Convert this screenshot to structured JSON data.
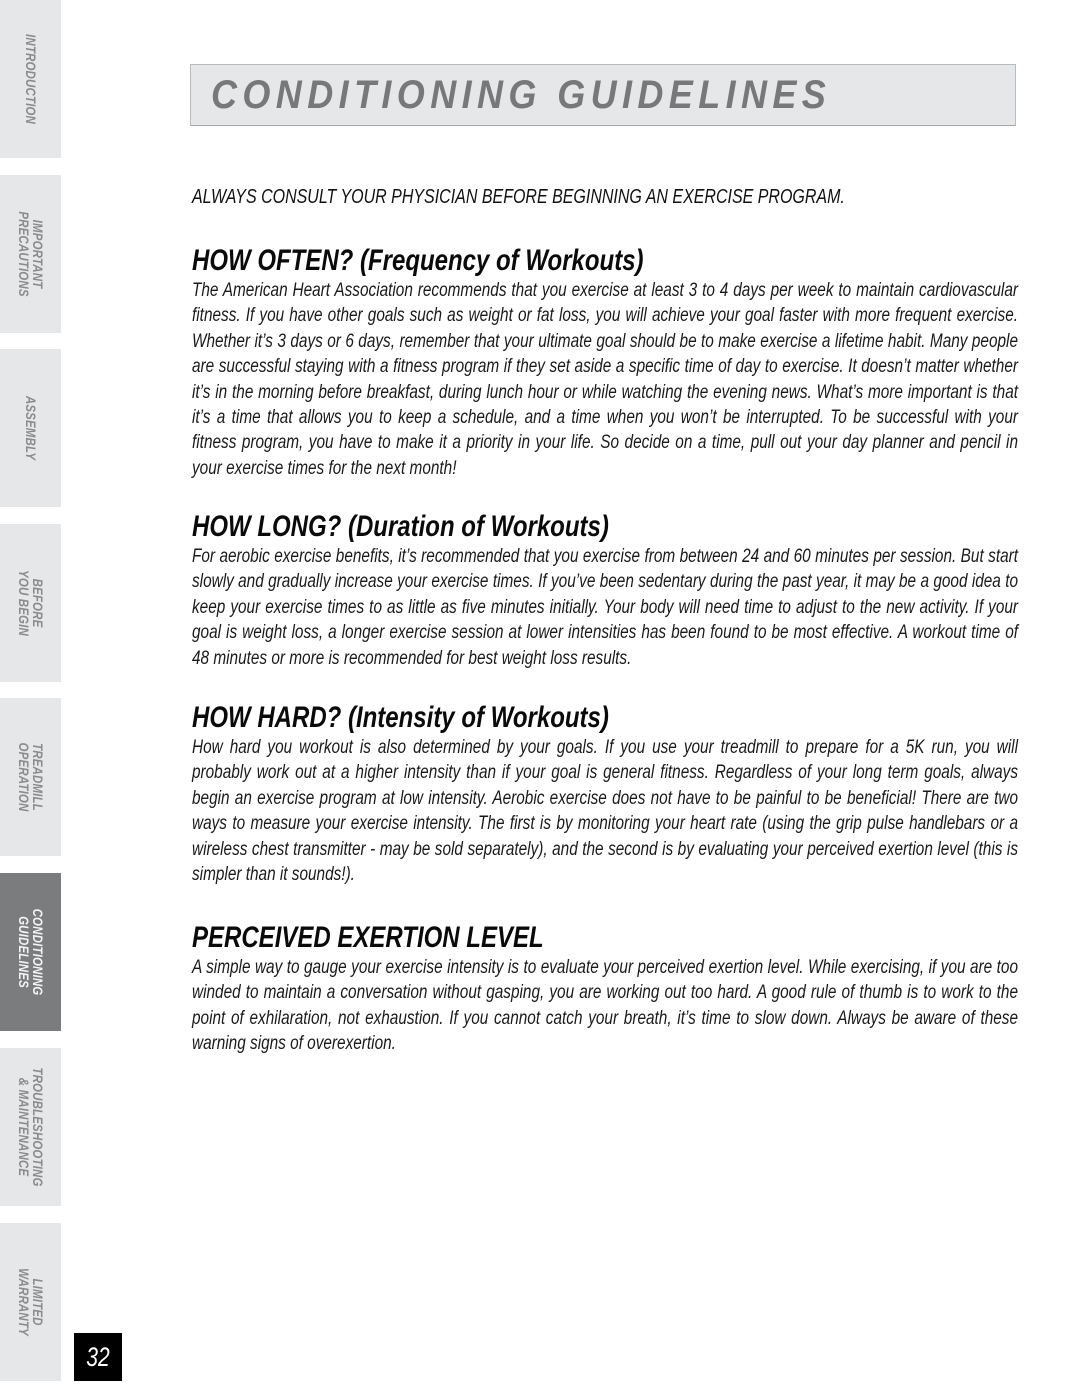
{
  "sidebar": {
    "tabs": [
      {
        "lines": [
          "INTRODUCTION"
        ],
        "active": false
      },
      {
        "lines": [
          "IMPORTANT",
          "PRECAUTIONS"
        ],
        "active": false
      },
      {
        "lines": [
          "ASSEMBLY"
        ],
        "active": false
      },
      {
        "lines": [
          "BEFORE",
          "YOU BEGIN"
        ],
        "active": false
      },
      {
        "lines": [
          "TREADMILL",
          "OPERATION"
        ],
        "active": false
      },
      {
        "lines": [
          "CONDITIONING",
          "GUIDELINES"
        ],
        "active": true
      },
      {
        "lines": [
          "TROUBLESHOOTING",
          "& MAINTENANCE"
        ],
        "active": false
      },
      {
        "lines": [
          "LIMITED",
          "WARRANTY"
        ],
        "active": false
      }
    ],
    "page_number": "32"
  },
  "header": {
    "title": "CONDITIONING GUIDELINES"
  },
  "content": {
    "warning": "ALWAYS CONSULT YOUR PHYSICIAN BEFORE BEGINNING AN EXERCISE PROGRAM.",
    "sections": [
      {
        "heading": "HOW OFTEN? (Frequency of Workouts)",
        "body": "The American Heart Association recommends that you exercise at least 3 to 4 days per week to maintain cardiovascular fitness. If you have other goals such as weight or fat loss, you will achieve your goal faster with more frequent exercise. Whether it’s 3 days or 6 days, remember that your ultimate goal should be to make exercise a lifetime habit. Many people are successful staying with a fitness program if they set aside a specific time of day to exercise. It doesn’t matter whether it’s in the morning before breakfast, during lunch hour or while watching the evening news. What’s more important is that it’s a time that allows you to keep a schedule, and a time when you won’t be interrupted. To be successful with your fitness program, you have to make it a priority in your life. So decide on a time, pull out your day planner and pencil in your exercise times for the next month!"
      },
      {
        "heading": "HOW LONG? (Duration of Workouts)",
        "body": "For aerobic exercise benefits, it’s recommended that you exercise from between 24 and 60 minutes per session. But start slowly and gradually increase your exercise times. If you’ve been sedentary during the past year, it may be a good idea to keep your exercise times to as little as five minutes initially. Your body will need time to adjust to the new activity. If your goal is weight loss, a longer exercise session at lower intensities has been found to be most effective. A workout time of 48 minutes or more is recommended for best weight loss results."
      },
      {
        "heading": "HOW HARD? (Intensity of Workouts)",
        "body": "How hard you workout is also determined by your goals. If you use your treadmill to prepare for a 5K run, you will probably work out at a higher intensity than if your goal is general fitness. Regardless of your long term goals, always begin an exercise program at low intensity. Aerobic exercise does not have to be painful to be beneficial! There are two ways to measure your exercise intensity. The first is by monitoring your heart rate (using the grip pulse handlebars or a wireless chest transmitter - may be sold separately), and the second is by evaluating your perceived exertion level (this is simpler than it sounds!)."
      },
      {
        "heading": "PERCEIVED EXERTION LEVEL",
        "body": "A simple way to gauge your exercise intensity is to evaluate your perceived exertion level. While exercising, if you are too winded to maintain a conversation without gasping, you are working out too hard. A good rule of thumb is to work to the point of exhilaration, not exhaustion. If you cannot catch your breath, it’s time to slow down. Always be aware of these warning signs of overexertion."
      }
    ]
  }
}
